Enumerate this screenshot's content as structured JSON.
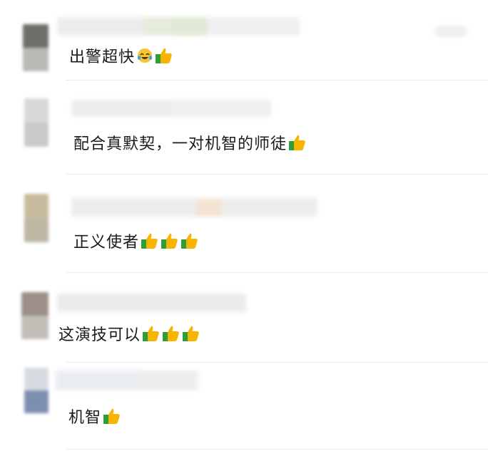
{
  "comments": [
    {
      "text": "出警超快",
      "emojis": [
        "laugh-cry-emoji",
        "thumbs-up-emoji"
      ]
    },
    {
      "text": "配合真默契，一对机智的师徒",
      "emojis": [
        "thumbs-up-emoji"
      ]
    },
    {
      "text": "正义使者",
      "emojis": [
        "thumbs-up-emoji",
        "thumbs-up-emoji",
        "thumbs-up-emoji"
      ]
    },
    {
      "text": "这演技可以",
      "emojis": [
        "thumbs-up-emoji",
        "thumbs-up-emoji",
        "thumbs-up-emoji"
      ]
    },
    {
      "text": "机智",
      "emojis": [
        "thumbs-up-emoji"
      ]
    }
  ],
  "colors": {
    "divider": "#ececec",
    "thumb": "#f7b500",
    "cuff": "#2e9e3a"
  }
}
